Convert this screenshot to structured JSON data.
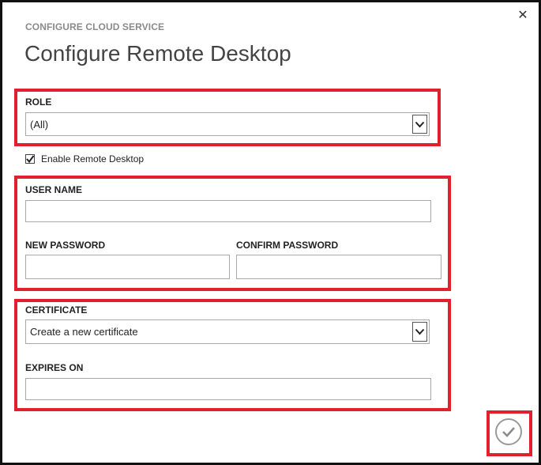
{
  "dialog": {
    "kicker": "CONFIGURE CLOUD SERVICE",
    "title": "Configure Remote Desktop",
    "close_glyph": "✕"
  },
  "role": {
    "label": "ROLE",
    "selected": "(All)"
  },
  "enable_rdp": {
    "label": "Enable Remote Desktop",
    "checked": true
  },
  "credentials": {
    "user_name_label": "USER NAME",
    "user_name_value": "",
    "new_password_label": "NEW PASSWORD",
    "new_password_value": "",
    "confirm_password_label": "CONFIRM PASSWORD",
    "confirm_password_value": ""
  },
  "certificate": {
    "label": "CERTIFICATE",
    "selected": "Create a new certificate",
    "expires_label": "EXPIRES ON",
    "expires_value": ""
  },
  "colors": {
    "highlight": "#e0202c",
    "border": "#a8a8a8",
    "kicker": "#8a8a8a"
  }
}
